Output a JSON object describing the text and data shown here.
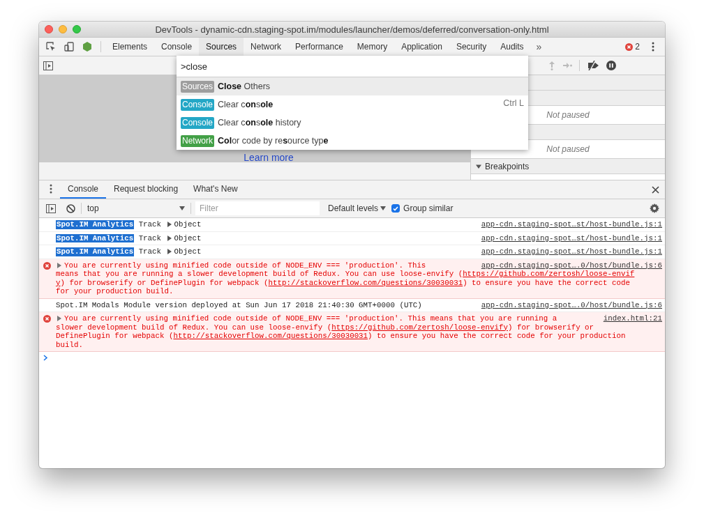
{
  "window": {
    "title": "DevTools - dynamic-cdn.staging-spot.im/modules/launcher/demos/deferred/conversation-only.html"
  },
  "main_tabs": [
    {
      "label": "Elements",
      "selected": false
    },
    {
      "label": "Console",
      "selected": false
    },
    {
      "label": "Sources",
      "selected": true
    },
    {
      "label": "Network",
      "selected": false
    },
    {
      "label": "Performance",
      "selected": false
    },
    {
      "label": "Memory",
      "selected": false
    },
    {
      "label": "Application",
      "selected": false
    },
    {
      "label": "Security",
      "selected": false
    },
    {
      "label": "Audits",
      "selected": false
    }
  ],
  "more_tabs": "»",
  "error_count": "2",
  "command_menu": {
    "value": ">close",
    "items": [
      {
        "category": "Sources",
        "color": "#9e9e9e",
        "text": "**Close** Others",
        "selected": true
      },
      {
        "category": "Console",
        "color": "#24a7c6",
        "text": "Clear c**on**s**ole**",
        "shortcut": "Ctrl L",
        "selected": false
      },
      {
        "category": "Console",
        "color": "#24a7c6",
        "text": "Clear c**on**s**ole** history",
        "selected": false
      },
      {
        "category": "Network",
        "color": "#43a047",
        "text": "**Col**or code by re**s**ource typ**e**",
        "selected": false
      }
    ]
  },
  "editor": {
    "link": "Learn more"
  },
  "debugger_sidebar": {
    "rows": [
      {
        "kind": "header"
      },
      {
        "kind": "header"
      },
      {
        "kind": "status",
        "text": "Not paused"
      },
      {
        "kind": "header"
      },
      {
        "kind": "status",
        "text": "Not paused"
      },
      {
        "kind": "header",
        "title": "Breakpoints",
        "expanded": true
      },
      {
        "kind": "empty"
      }
    ]
  },
  "drawer": {
    "tabs": [
      {
        "label": "Console",
        "selected": true
      },
      {
        "label": "Request blocking",
        "selected": false
      },
      {
        "label": "What's New",
        "selected": false
      }
    ]
  },
  "console_toolbar": {
    "context": "top",
    "filter_placeholder": "Filter",
    "levels": "Default levels",
    "group_similar": {
      "label": "Group similar",
      "checked": true
    }
  },
  "messages": [
    {
      "kind": "log",
      "label": "Spot.IM Analytics",
      "text": "Track",
      "object": "Object",
      "source": "app-cdn.staging-spot…st/host-bundle.js:1"
    },
    {
      "kind": "log",
      "label": "Spot.IM Analytics",
      "text": "Track",
      "object": "Object",
      "source": "app-cdn.staging-spot…st/host-bundle.js:1"
    },
    {
      "kind": "log",
      "label": "Spot.IM Analytics",
      "text": "Track",
      "object": "Object",
      "source": "app-cdn.staging-spot…st/host-bundle.js:1"
    },
    {
      "kind": "error",
      "source": "app-cdn.staging-spot….0/host/bundle.js:6",
      "lines": [
        [
          {
            "text": "You are currently using minified code outside of NODE_ENV === 'production'. This",
            "link": false
          }
        ],
        [
          {
            "text": "means that you are running a slower development build of Redux. You can use loose-envify (",
            "link": false
          },
          {
            "text": "https://github.com/zertosh/loose-envif",
            "link": true
          }
        ],
        [
          {
            "text": "y",
            "link": true
          },
          {
            "text": ") for browserify or DefinePlugin for webpack (",
            "link": false
          },
          {
            "text": "http://stackoverflow.com/questions/30030031",
            "link": true
          },
          {
            "text": ") to ensure you have the correct code",
            "link": false
          }
        ],
        [
          {
            "text": "for your production build.",
            "link": false
          }
        ]
      ]
    },
    {
      "kind": "info",
      "text": "Spot.IM Modals Module version deployed at Sun Jun 17 2018 21:40:30 GMT+0000 (UTC)",
      "source": "app-cdn.staging-spot….0/host/bundle.js:6"
    },
    {
      "kind": "error",
      "source": "index.html:21",
      "lines": [
        [
          {
            "text": "You are currently using minified code outside of NODE_ENV === 'production'. This means that you are running a",
            "link": false
          }
        ],
        [
          {
            "text": "slower development build of Redux. You can use loose-envify (",
            "link": false
          },
          {
            "text": "https://github.com/zertosh/loose-envify",
            "link": true
          },
          {
            "text": ") for browserify or",
            "link": false
          }
        ],
        [
          {
            "text": "DefinePlugin for webpack (",
            "link": false
          },
          {
            "text": "http://stackoverflow.com/questions/30030031",
            "link": true
          },
          {
            "text": ") to ensure you have the correct code for your production",
            "link": false
          }
        ],
        [
          {
            "text": "build.",
            "link": false
          }
        ]
      ]
    }
  ]
}
